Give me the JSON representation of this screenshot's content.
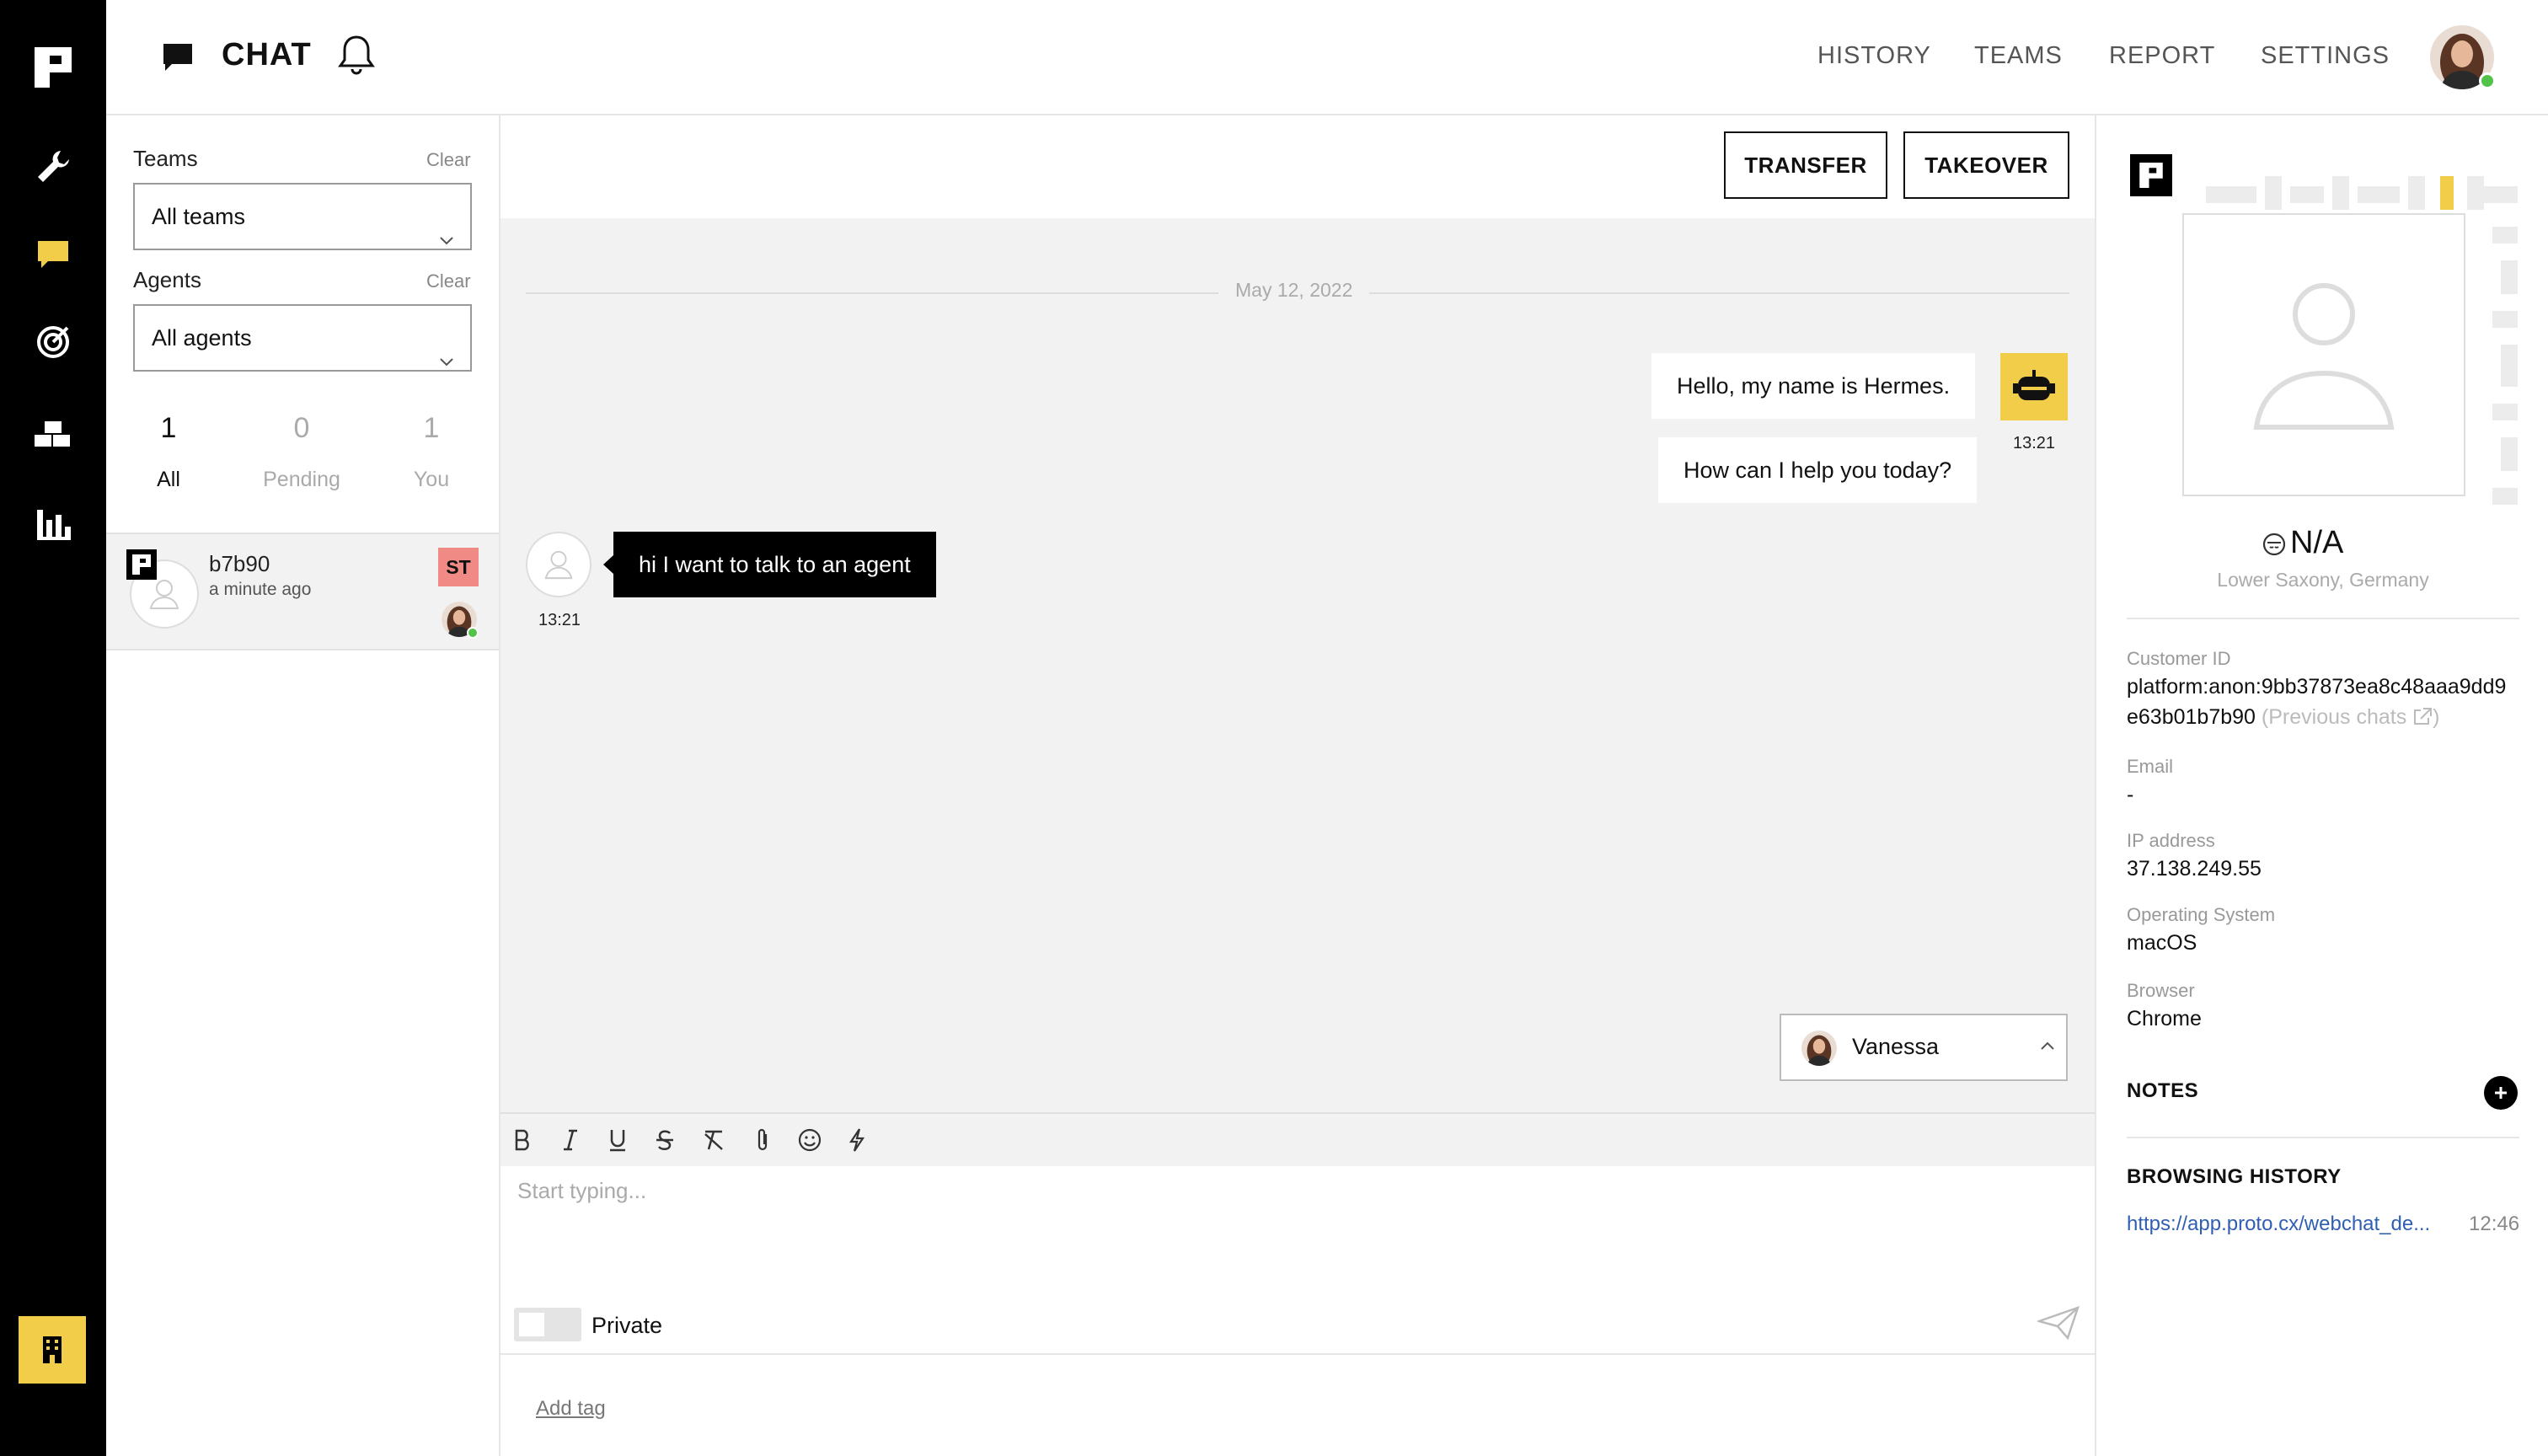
{
  "app": {
    "title": "CHAT"
  },
  "nav": {
    "items": [
      "HISTORY",
      "TEAMS",
      "REPORT",
      "SETTINGS"
    ]
  },
  "filters": {
    "teams_label": "Teams",
    "teams_clear": "Clear",
    "teams_value": "All teams",
    "agents_label": "Agents",
    "agents_clear": "Clear",
    "agents_value": "All agents",
    "counts": [
      {
        "num": "1",
        "label": "All"
      },
      {
        "num": "0",
        "label": "Pending"
      },
      {
        "num": "1",
        "label": "You"
      }
    ]
  },
  "chat_list": {
    "items": [
      {
        "name": "b7b90",
        "time": "a minute ago",
        "badge": "ST"
      }
    ]
  },
  "conversation": {
    "transfer_label": "TRANSFER",
    "takeover_label": "TAKEOVER",
    "date_divider": "May 12, 2022",
    "messages": [
      {
        "from": "bot",
        "text": "Hello, my name is Hermes."
      },
      {
        "from": "bot",
        "text": "How can I help you today?"
      },
      {
        "from": "user",
        "text": "hi I want to talk to an agent"
      }
    ],
    "bot_time": "13:21",
    "user_time": "13:21",
    "agent_select": "Vanessa"
  },
  "editor": {
    "placeholder": "Start typing...",
    "private_label": "Private",
    "add_tag": "Add tag"
  },
  "details": {
    "name": "N/A",
    "location": "Lower Saxony, Germany",
    "customer_id_label": "Customer ID",
    "customer_id_line1": "platform:anon:9bb37873ea8c48aaa9dd9",
    "customer_id_line2": "e63b01b7b90",
    "previous_chats": "(Previous chats",
    "email_label": "Email",
    "email_value": "-",
    "ip_label": "IP address",
    "ip_value": "37.138.249.55",
    "os_label": "Operating System",
    "os_value": "macOS",
    "browser_label": "Browser",
    "browser_value": "Chrome",
    "notes_title": "NOTES",
    "browsing_title": "BROWSING HISTORY",
    "browsing": [
      {
        "url": "https://app.proto.cx/webchat_de...",
        "time": "12:46"
      }
    ]
  },
  "colors": {
    "accent_yellow": "#f2cd4a",
    "badge_red": "#f08a84",
    "online_green": "#52c24a",
    "link_blue": "#2f5fb3"
  },
  "icons": {
    "rail": [
      "proto-logo-icon",
      "wrench-icon",
      "chat-bubble-icon",
      "target-icon",
      "blocks-icon",
      "bar-chart-icon",
      "building-icon"
    ]
  }
}
